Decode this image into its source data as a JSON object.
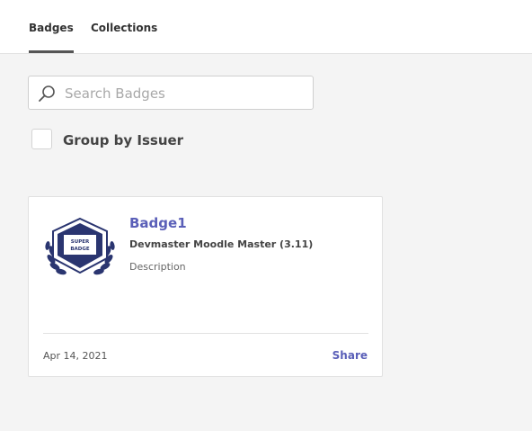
{
  "tabs": [
    {
      "label": "Badges",
      "active": true
    },
    {
      "label": "Collections",
      "active": false
    }
  ],
  "search": {
    "placeholder": "Search Badges",
    "value": ""
  },
  "group_by": {
    "label": "Group by Issuer",
    "checked": false
  },
  "badges": [
    {
      "name": "Badge1",
      "issuer": "Devmaster Moodle Master (3.11)",
      "description": "Description",
      "date": "Apr 14, 2021",
      "share_label": "Share",
      "image_text_line1": "SUPER",
      "image_text_line2": "BADGE",
      "image_color": "#2a3570"
    }
  ],
  "colors": {
    "accent": "#5a5fb8",
    "background": "#f4f4f4"
  }
}
